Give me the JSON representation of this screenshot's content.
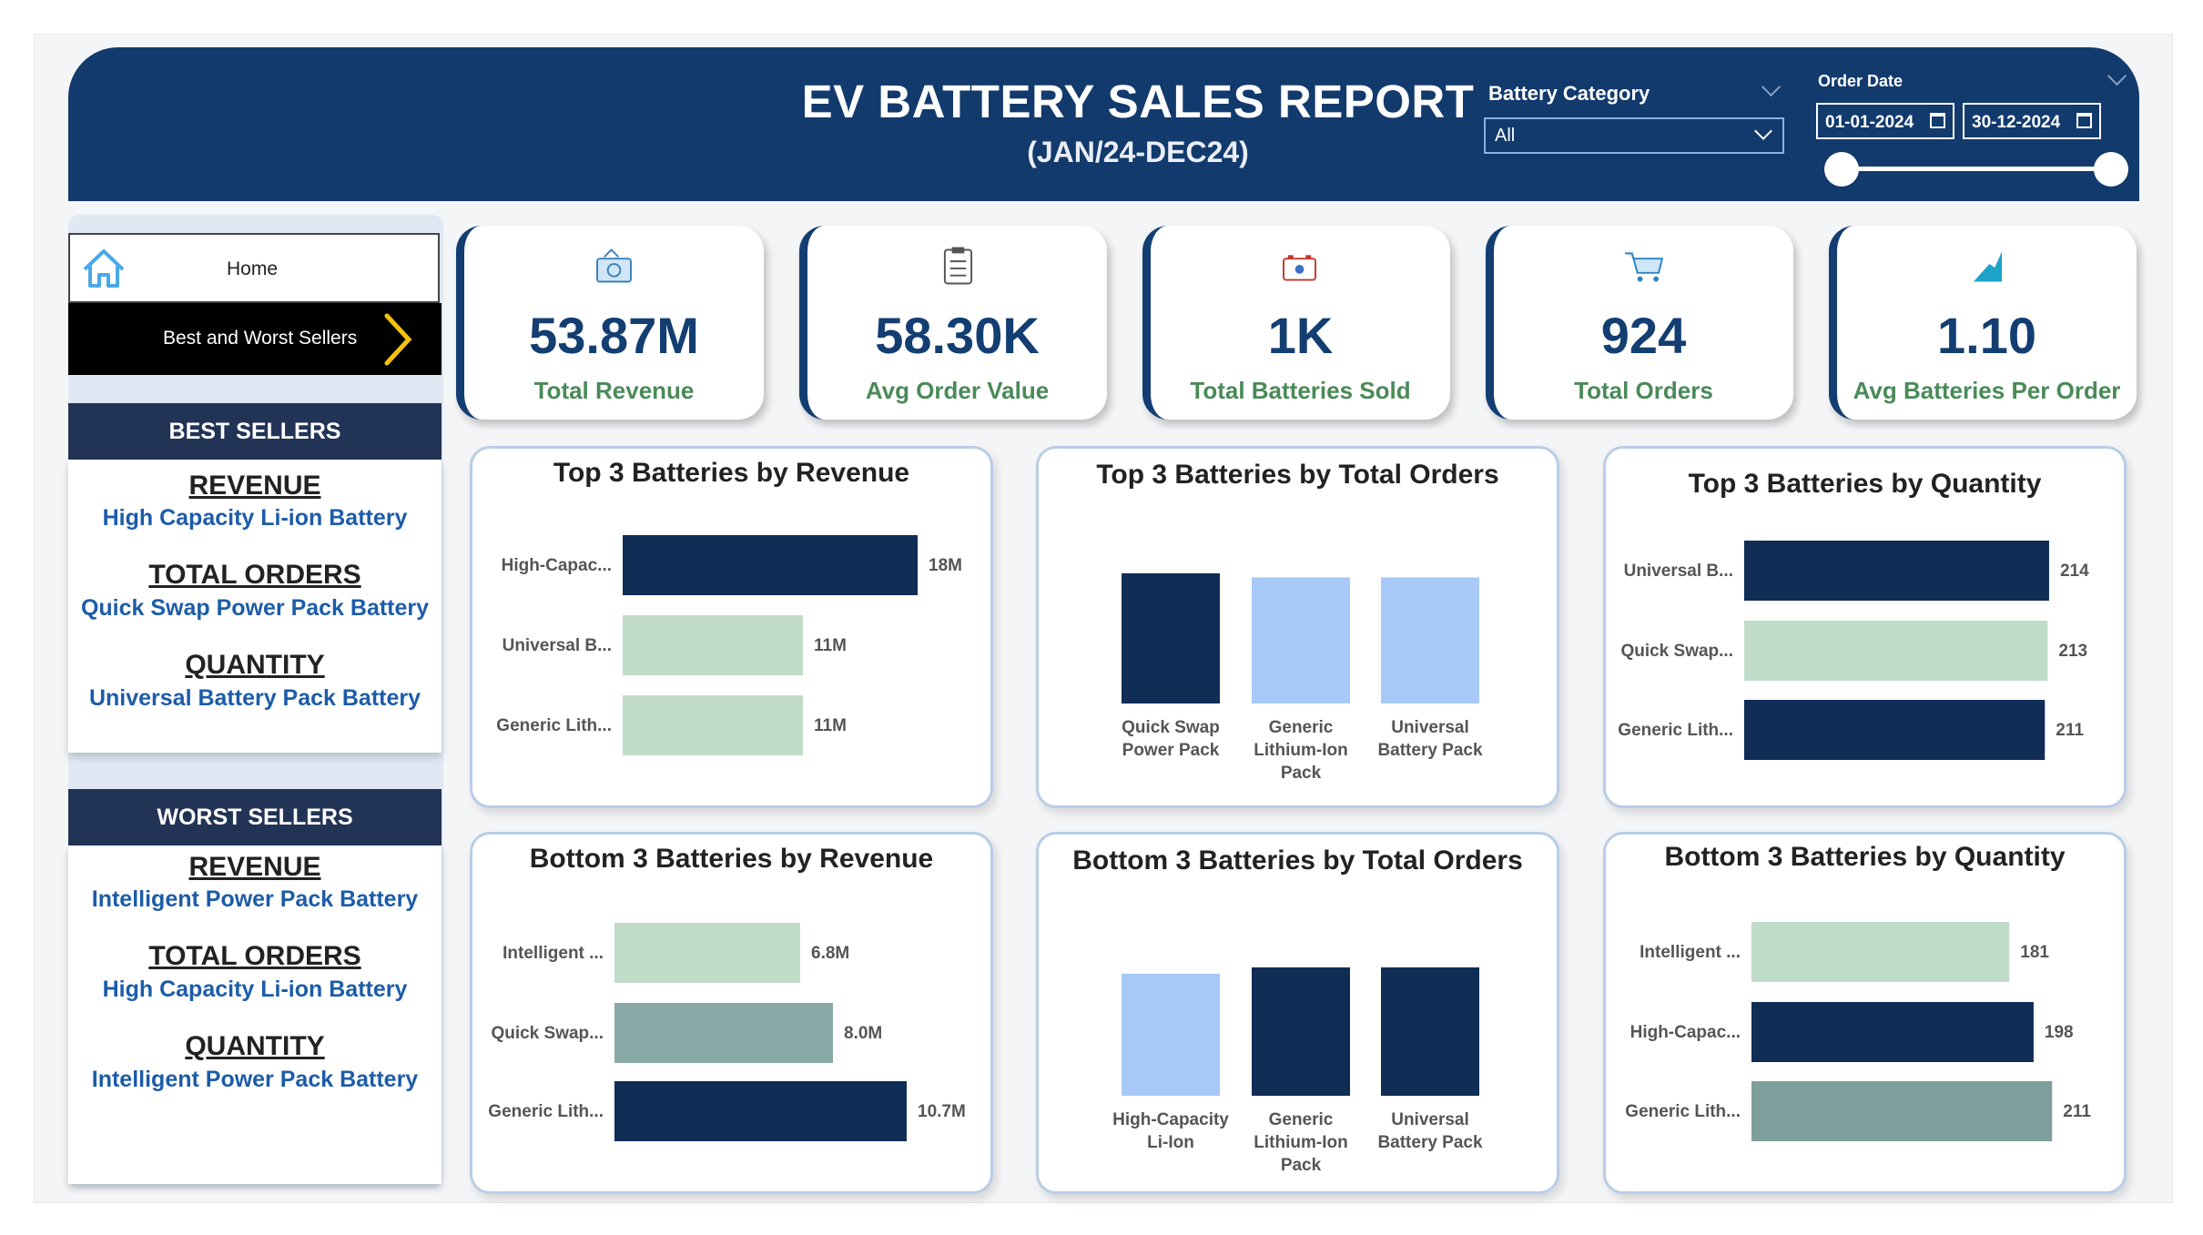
{
  "header": {
    "title": "EV BATTERY SALES REPORT",
    "subtitle": "(JAN/24-DEC24)",
    "battery_category_label": "Battery Category",
    "battery_category_value": "All",
    "order_date_label": "Order Date",
    "date_start": "01-01-2024",
    "date_end": "30-12-2024",
    "accent_color": "#123a6d"
  },
  "nav": {
    "home_label": "Home",
    "best_worst_label": "Best and Worst Sellers"
  },
  "best_sellers": {
    "title": "BEST SELLERS",
    "revenue_heading": "REVENUE",
    "revenue_value": "High Capacity Li-ion Battery",
    "orders_heading": "TOTAL ORDERS",
    "orders_value": "Quick Swap Power Pack Battery",
    "quantity_heading": "QUANTITY",
    "quantity_value": "Universal Battery Pack Battery"
  },
  "worst_sellers": {
    "title": "WORST SELLERS",
    "revenue_heading": "REVENUE",
    "revenue_value": "Intelligent Power Pack  Battery",
    "orders_heading": "TOTAL ORDERS",
    "orders_value": "High Capacity Li-ion Battery",
    "quantity_heading": "QUANTITY",
    "quantity_value": "Intelligent Power Pack  Battery"
  },
  "kpis": [
    {
      "value": "53.87M",
      "label": "Total Revenue",
      "icon": "money-icon"
    },
    {
      "value": "58.30K",
      "label": "Avg Order Value",
      "icon": "clipboard-icon"
    },
    {
      "value": "1K",
      "label": "Total Batteries Sold",
      "icon": "battery-icon"
    },
    {
      "value": "924",
      "label": "Total Orders",
      "icon": "cart-icon"
    },
    {
      "value": "1.10",
      "label": "Avg Batteries Per Order",
      "icon": "growth-icon"
    }
  ],
  "chart_data": [
    {
      "type": "bar",
      "orientation": "horizontal",
      "title": "Top 3 Batteries by Revenue",
      "categories": [
        "High-Capac...",
        "Universal B...",
        "Generic Lith..."
      ],
      "values": [
        18,
        11,
        11
      ],
      "labels": [
        "18M",
        "11M",
        "11M"
      ],
      "colors": [
        "#0f2d55",
        "#bfdcc9",
        "#bfdcc9"
      ],
      "xlim": [
        0,
        20
      ]
    },
    {
      "type": "bar",
      "orientation": "vertical",
      "title": "Top 3 Batteries by Total Orders",
      "categories": [
        [
          "Quick Swap",
          "Power Pack"
        ],
        [
          "Generic",
          "Lithium-Ion",
          "Pack"
        ],
        [
          "Universal",
          "Battery Pack"
        ]
      ],
      "values": [
        320,
        310,
        310
      ],
      "colors": [
        "#0f2d55",
        "#a7c9f7",
        "#a7c9f7"
      ],
      "ylim": [
        0,
        340
      ]
    },
    {
      "type": "bar",
      "orientation": "horizontal",
      "title": "Top 3 Batteries by Quantity",
      "categories": [
        "Universal B...",
        "Quick Swap...",
        "Generic Lith..."
      ],
      "values": [
        214,
        213,
        211
      ],
      "labels": [
        "214",
        "213",
        "211"
      ],
      "colors": [
        "#0f2d55",
        "#bfdcc9",
        "#0f2d55"
      ],
      "xlim": [
        0,
        230
      ]
    },
    {
      "type": "bar",
      "orientation": "horizontal",
      "title": "Bottom 3 Batteries by Revenue",
      "categories": [
        "Intelligent ...",
        "Quick Swap...",
        "Generic Lith..."
      ],
      "values": [
        6.8,
        8.0,
        10.7
      ],
      "labels": [
        "6.8M",
        "8.0M",
        "10.7M"
      ],
      "colors": [
        "#bfdcc9",
        "#88a8a6",
        "#0f2d55"
      ],
      "xlim": [
        0,
        12
      ]
    },
    {
      "type": "bar",
      "orientation": "vertical",
      "title": "Bottom 3 Batteries by Total Orders",
      "categories": [
        [
          "High-Capacity",
          "Li-Ion"
        ],
        [
          "Generic",
          "Lithium-Ion",
          "Pack"
        ],
        [
          "Universal",
          "Battery Pack"
        ]
      ],
      "values": [
        290,
        305,
        305
      ],
      "colors": [
        "#a7c9f7",
        "#0f2d55",
        "#0f2d55"
      ],
      "ylim": [
        0,
        320
      ]
    },
    {
      "type": "bar",
      "orientation": "horizontal",
      "title": "Bottom 3 Batteries by Quantity",
      "categories": [
        "Intelligent ...",
        "High-Capac...",
        "Generic Lith..."
      ],
      "values": [
        181,
        198,
        211
      ],
      "labels": [
        "181",
        "198",
        "211"
      ],
      "colors": [
        "#bfdcc9",
        "#0f2d55",
        "#7f9f9c"
      ],
      "xlim": [
        0,
        230
      ]
    }
  ]
}
